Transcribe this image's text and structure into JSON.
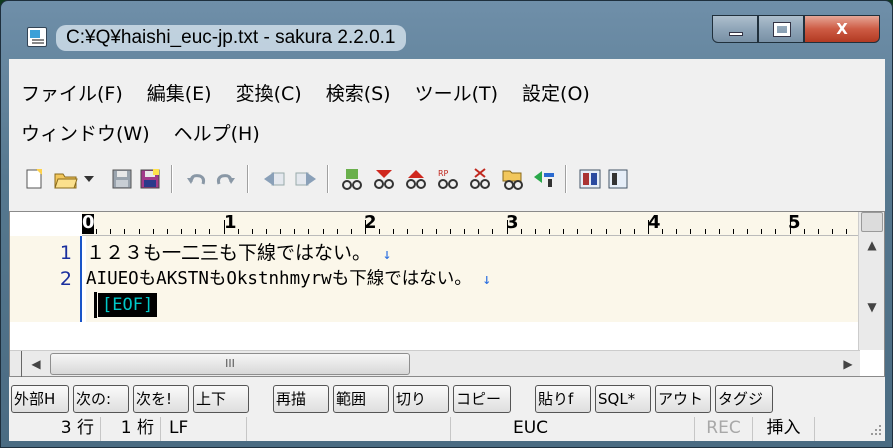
{
  "window": {
    "title": "C:¥Q¥haishi_euc-jp.txt - sakura 2.2.0.1",
    "close_label": "X"
  },
  "menu": {
    "row1": [
      "ファイル(F)",
      "編集(E)",
      "変換(C)",
      "検索(S)",
      "ツール(T)",
      "設定(O)"
    ],
    "row2": [
      "ウィンドウ(W)",
      "ヘルプ(H)"
    ]
  },
  "toolbar": {
    "icons": [
      "new-file-icon",
      "open-folder-icon",
      "dropdown-arrow-icon",
      "save-icon",
      "save-all-icon",
      "undo-icon",
      "redo-icon",
      "jump-back-icon",
      "jump-forward-icon",
      "search-icon",
      "find-next-icon",
      "find-prev-icon",
      "replace-icon",
      "delete-icon",
      "grep-icon",
      "bookmark-icon",
      "compare-icon",
      "settings-icon"
    ]
  },
  "ruler": {
    "labels": [
      "0",
      "1",
      "2",
      "3",
      "4",
      "5"
    ]
  },
  "editor": {
    "line_numbers": [
      "1",
      "2"
    ],
    "lines": [
      "１２３も一二三も下線ではない。",
      "AIUEOもAKSTNもOkstnhmyrwも下線ではない。"
    ],
    "eol_mark": "↓",
    "eof_label": "[EOF]",
    "hscroll_grip": "III"
  },
  "function_keys": [
    "外部H",
    "次の:",
    "次を!",
    "上下",
    "再描",
    "範囲",
    "切り",
    "コピー",
    "貼りf",
    "SQL*",
    "アウト",
    "タグジ"
  ],
  "status": {
    "row": "3 行",
    "col": "1 桁",
    "eol": "LF",
    "encoding": "EUC",
    "rec": "REC",
    "mode": "挿入"
  }
}
